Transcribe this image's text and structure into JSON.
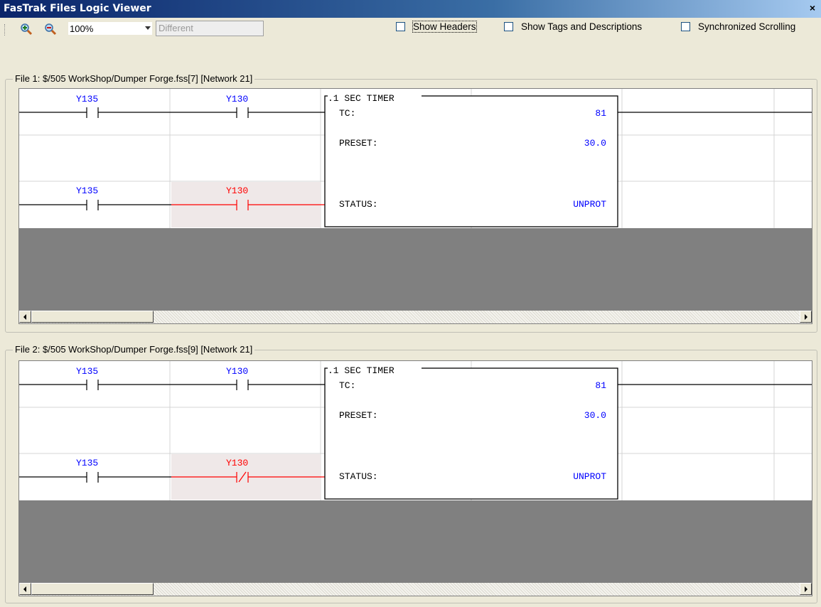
{
  "window": {
    "title": "FasTrak Files Logic Viewer",
    "close_symbol": "×"
  },
  "toolbar": {
    "zoom_in_icon": "zoom-in-icon",
    "zoom_out_icon": "zoom-out-icon",
    "zoom_value": "100%",
    "filter_value": "Different",
    "checkboxes": [
      {
        "label": "Show Headers",
        "checked": false
      },
      {
        "label": "Show Tags and Descriptions",
        "checked": false
      },
      {
        "label": "Synchronized Scrolling",
        "checked": false
      }
    ]
  },
  "panes": [
    {
      "legend": "File 1: $/505 WorkShop/Dumper Forge.fss[7] [Network 21]",
      "rung1": {
        "contact1": "Y135",
        "contact2": "Y130"
      },
      "rung2": {
        "contact1": "Y135",
        "contact2": "Y130",
        "contact2_type": "normally-open",
        "highlighted": true
      },
      "timer": {
        "title": ".1 SEC TIMER",
        "tc_label": "TC:",
        "tc_value": "81",
        "preset_label": "PRESET:",
        "preset_value": "30.0",
        "status_label": "STATUS:",
        "status_value": "UNPROT"
      }
    },
    {
      "legend": "File 2: $/505 WorkShop/Dumper Forge.fss[9] [Network 21]",
      "rung1": {
        "contact1": "Y135",
        "contact2": "Y130"
      },
      "rung2": {
        "contact1": "Y135",
        "contact2": "Y130",
        "contact2_type": "normally-closed",
        "highlighted": true
      },
      "timer": {
        "title": ".1 SEC TIMER",
        "tc_label": "TC:",
        "tc_value": "81",
        "preset_label": "PRESET:",
        "preset_value": "30.0",
        "status_label": "STATUS:",
        "status_value": "UNPROT"
      }
    }
  ],
  "colors": {
    "tag_blue": "#0000ff",
    "diff_red": "#ff0000",
    "diff_highlight": "#efe8e8",
    "value_blue": "#0000ff"
  }
}
